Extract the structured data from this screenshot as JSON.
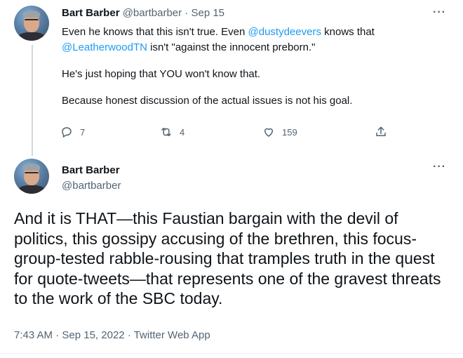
{
  "tweet1": {
    "display_name": "Bart Barber",
    "handle": "@bartbarber",
    "separator": "·",
    "date": "Sep 15",
    "more_label": "···",
    "text": {
      "line1_before": "Even he knows that this isn't true. Even ",
      "line1_mention": "@dustydeevers",
      "line1_after": " knows that",
      "line2_mention": "@LeatherwoodTN",
      "line2_after": " isn't \"against the innocent preborn.\"",
      "para2": "He's just hoping that YOU won't know that.",
      "para3": "Because honest discussion of the actual issues is not his goal."
    },
    "actions": {
      "reply_count": "7",
      "retweet_count": "4",
      "like_count": "159"
    }
  },
  "tweet2": {
    "display_name": "Bart Barber",
    "handle": "@bartbarber",
    "more_label": "···",
    "text": "And it is THAT—this Faustian bargain with the devil of politics, this gossipy accusing of the brethren, this focus-group-tested rabble-rousing that tramples truth in the quest for quote-tweets—that represents one of the gravest threats to the work of the SBC today.",
    "time": "7:43 AM",
    "date": "Sep 15, 2022",
    "separator": "·",
    "source": "Twitter Web App"
  },
  "colors": {
    "link": "#1d9bf0",
    "secondary_text": "#536471",
    "primary_text": "#0f1419",
    "divider": "#cfd9de"
  },
  "icons": [
    "reply-icon",
    "retweet-icon",
    "like-icon",
    "share-icon",
    "more-icon"
  ]
}
